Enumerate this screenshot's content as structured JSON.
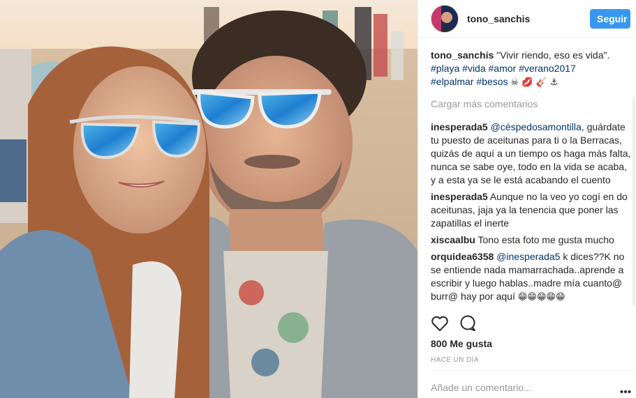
{
  "post": {
    "author": "tono_sanchis",
    "follow_label": "Seguir",
    "caption": {
      "user": "tono_sanchis",
      "text": "\"Vivir riendo, eso es vida\".",
      "hashtags_line1": [
        "#playa",
        "#vida",
        "#amor",
        "#verano2017"
      ],
      "hashtags_line2": [
        "#elpalmar",
        "#besos"
      ],
      "emojis": "☠ 💋 🎸 ⚓"
    },
    "load_more": "Cargar más comentarios",
    "comments": [
      {
        "user": "inesperada5",
        "mention": "@céspedosamontilla,",
        "text": "guárdate tu puesto de aceitunas para ti o la Berracas, quizás de aquí a un tiempo os haga más falta, nunca se sabe oye, todo en la vida se acaba, y a esta ya se le está acabando el cuento"
      },
      {
        "user": "inesperada5",
        "mention": "",
        "text": "Aunque no la veo yo cogí en do aceitunas, jaja ya la tenencia que poner las zapatillas el inerte"
      },
      {
        "user": "xiscaalbu",
        "mention": "",
        "text": "Tono esta foto me gusta mucho"
      },
      {
        "user": "orquidea6358",
        "mention": "@inesperada5",
        "text": "k dices??K no se entiende nada mamarrachada..aprende a escribir y luego hablas..madre mía cuanto@ burr@ hay por aquí",
        "emojis": "😁😁😁😁😁"
      }
    ],
    "likes": "800 Me gusta",
    "time": "HACE UN DÍA",
    "add_comment_placeholder": "Añade un comentario..."
  },
  "icons": {
    "like": "heart-icon",
    "comment": "speech-bubble-icon",
    "more": "more-options-icon"
  },
  "colors": {
    "follow_button": "#3897f0",
    "link": "#003569",
    "muted": "#999999",
    "text": "#262626"
  }
}
